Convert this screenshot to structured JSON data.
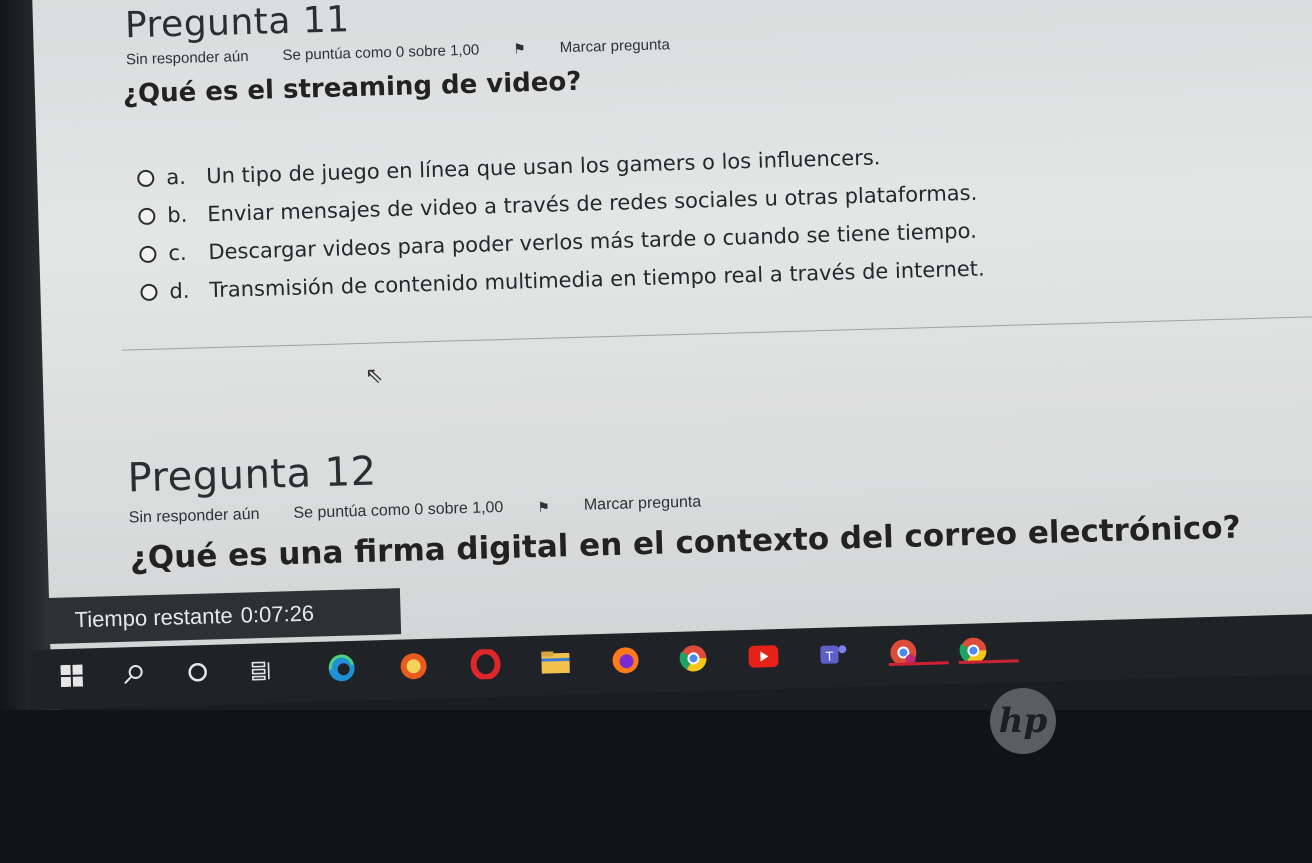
{
  "question11": {
    "title": "Pregunta 11",
    "status": "Sin responder aún",
    "score": "Se puntúa como 0 sobre 1,00",
    "flag_label": "Marcar pregunta",
    "text": "¿Qué es el streaming de video?",
    "options": [
      {
        "letter": "a.",
        "text": "Un tipo de juego en línea que usan los gamers o los influencers."
      },
      {
        "letter": "b.",
        "text": "Enviar mensajes de video a través de redes sociales u otras plataformas."
      },
      {
        "letter": "c.",
        "text": "Descargar videos para poder verlos más tarde o cuando se tiene tiempo."
      },
      {
        "letter": "d.",
        "text": "Transmisión de contenido multimedia en tiempo real a través de internet."
      }
    ]
  },
  "question12": {
    "title": "Pregunta 12",
    "status": "Sin responder aún",
    "score": "Se puntúa como 0 sobre 1,00",
    "flag_label": "Marcar pregunta",
    "text": "¿Qué es una firma digital en el contexto del correo electrónico?"
  },
  "timer": {
    "label": "Tiempo restante",
    "value": "0:07:26"
  },
  "taskbar": {
    "icons": [
      "windows-start-icon",
      "search-icon",
      "cortana-icon",
      "task-view-icon",
      "edge-icon",
      "brave-icon",
      "opera-icon",
      "file-explorer-icon",
      "firefox-icon",
      "chrome-icon",
      "youtube-icon",
      "teams-icon",
      "chrome-profile-icon",
      "chrome-icon-2"
    ]
  },
  "brand": {
    "logo": "hp"
  }
}
